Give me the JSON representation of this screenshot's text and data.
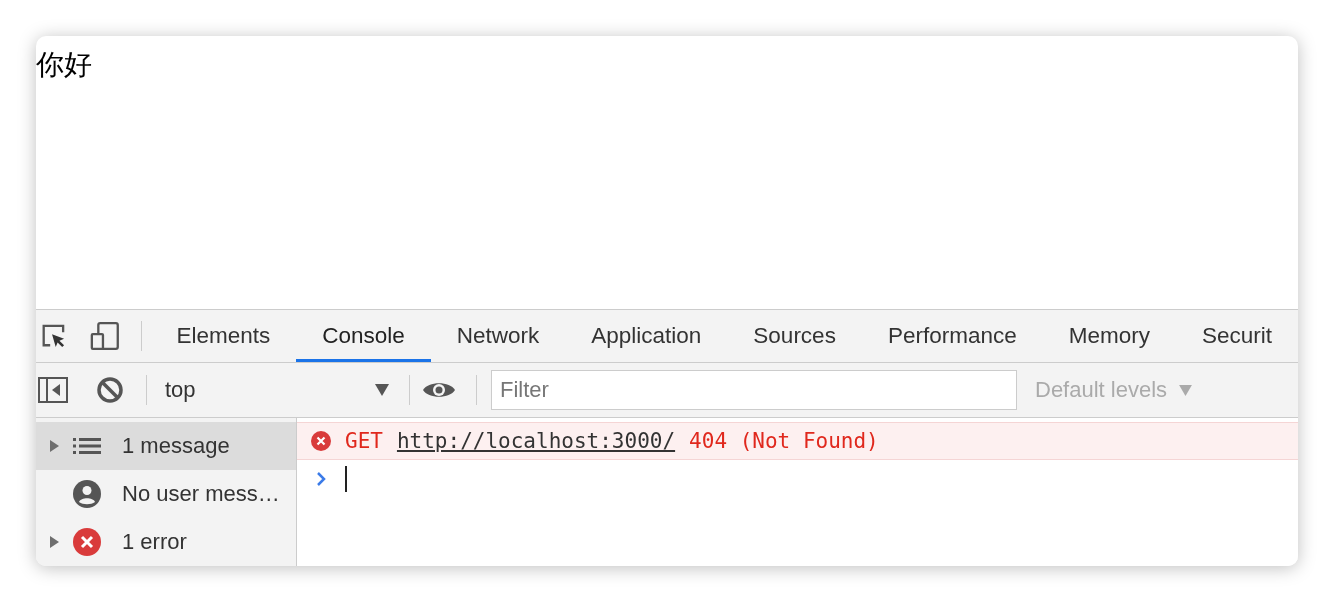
{
  "page": {
    "text": "你好"
  },
  "devtools": {
    "tabs": [
      {
        "label": "Elements",
        "selected": false
      },
      {
        "label": "Console",
        "selected": true
      },
      {
        "label": "Network",
        "selected": false
      },
      {
        "label": "Application",
        "selected": false
      },
      {
        "label": "Sources",
        "selected": false
      },
      {
        "label": "Performance",
        "selected": false
      },
      {
        "label": "Memory",
        "selected": false
      },
      {
        "label": "Securit",
        "selected": false
      }
    ],
    "toolbar": {
      "context": "top",
      "filter_placeholder": "Filter",
      "levels": "Default levels"
    },
    "sidebar": [
      {
        "kind": "messages",
        "label": "1 message",
        "expandable": true,
        "selected": true
      },
      {
        "kind": "user",
        "label": "No user mess…",
        "expandable": false,
        "selected": false
      },
      {
        "kind": "error",
        "label": "1 error",
        "expandable": true,
        "selected": false
      }
    ],
    "console": {
      "messages": [
        {
          "kind": "error",
          "method": "GET",
          "url": "http://localhost:3000/",
          "status": "404 (Not Found)"
        }
      ]
    }
  }
}
